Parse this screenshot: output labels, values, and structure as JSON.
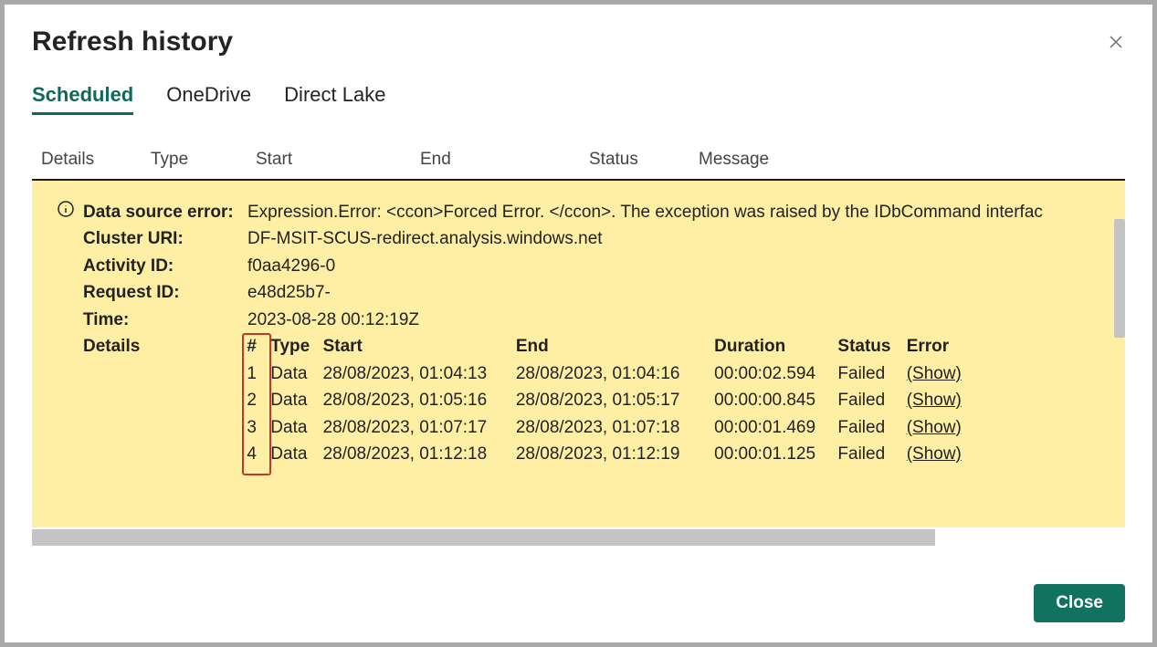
{
  "title": "Refresh history",
  "tabs": [
    {
      "label": "Scheduled",
      "active": true
    },
    {
      "label": "OneDrive",
      "active": false
    },
    {
      "label": "Direct Lake",
      "active": false
    }
  ],
  "columns": [
    "Details",
    "Type",
    "Start",
    "End",
    "Status",
    "Message"
  ],
  "error": {
    "data_source_label": "Data source error:",
    "data_source_value": "Expression.Error: <ccon>Forced Error. </ccon>. The exception was raised by the IDbCommand interfac",
    "cluster_uri_label": "Cluster URI:",
    "cluster_uri_value": "DF-MSIT-SCUS-redirect.analysis.windows.net",
    "activity_id_label": "Activity ID:",
    "activity_id_value": "f0aa4296-0",
    "request_id_label": "Request ID:",
    "request_id_value": "e48d25b7-",
    "time_label": "Time:",
    "time_value": "2023-08-28 00:12:19Z",
    "details_label": "Details"
  },
  "details_headers": {
    "num": "#",
    "type": "Type",
    "start": "Start",
    "end": "End",
    "duration": "Duration",
    "status": "Status",
    "error": "Error"
  },
  "details_rows": [
    {
      "num": "1",
      "type": "Data",
      "start": "28/08/2023, 01:04:13",
      "end": "28/08/2023, 01:04:16",
      "duration": "00:00:02.594",
      "status": "Failed",
      "error": "(Show)"
    },
    {
      "num": "2",
      "type": "Data",
      "start": "28/08/2023, 01:05:16",
      "end": "28/08/2023, 01:05:17",
      "duration": "00:00:00.845",
      "status": "Failed",
      "error": "(Show)"
    },
    {
      "num": "3",
      "type": "Data",
      "start": "28/08/2023, 01:07:17",
      "end": "28/08/2023, 01:07:18",
      "duration": "00:00:01.469",
      "status": "Failed",
      "error": "(Show)"
    },
    {
      "num": "4",
      "type": "Data",
      "start": "28/08/2023, 01:12:18",
      "end": "28/08/2023, 01:12:19",
      "duration": "00:00:01.125",
      "status": "Failed",
      "error": "(Show)"
    }
  ],
  "close_button_label": "Close",
  "colors": {
    "accent": "#10725f",
    "panel": "#ffefa5"
  }
}
